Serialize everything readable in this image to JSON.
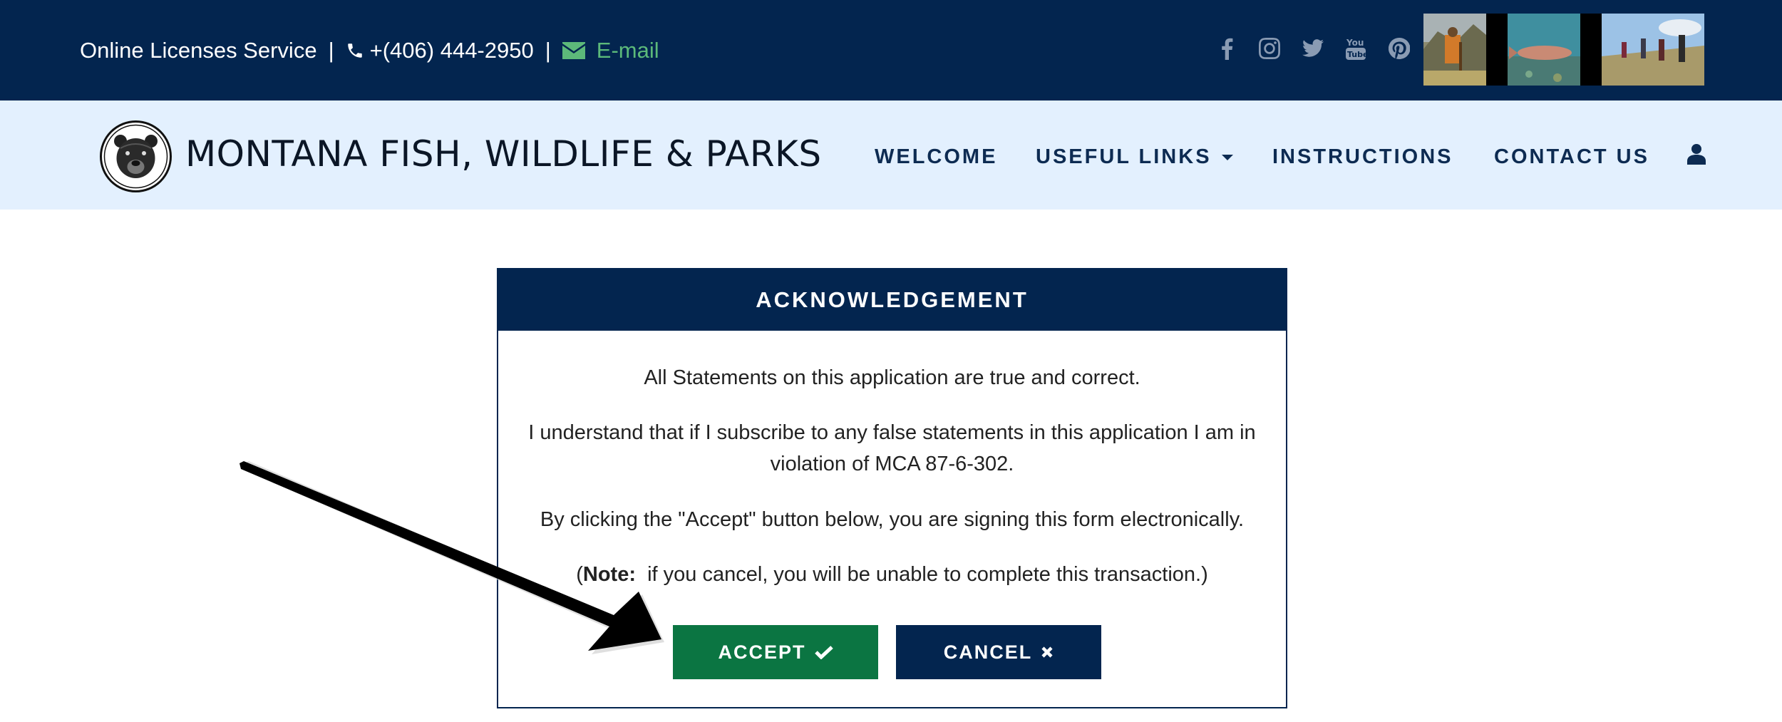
{
  "topbar": {
    "service": "Online Licenses Service",
    "separator": "|",
    "phone": "+(406) 444-2950",
    "email_label": "E-mail",
    "social_icons": [
      "facebook-icon",
      "instagram-icon",
      "twitter-icon",
      "youtube-icon",
      "pinterest-icon"
    ]
  },
  "nav": {
    "brand": "MONTANA FISH, WILDLIFE & PARKS",
    "welcome": "WELCOME",
    "useful_links": "USEFUL LINKS",
    "instructions": "INSTRUCTIONS",
    "contact_us": "CONTACT US",
    "user_icon": "user-icon"
  },
  "dialog": {
    "title": "ACKNOWLEDGEMENT",
    "line1": "All Statements on this application are true and correct.",
    "line2": "I understand that if I subscribe to any false statements in this application I am in violation of MCA 87-6-302.",
    "line3": "By clicking the \"Accept\" button below, you are signing this form electronically.",
    "note_open": "(",
    "note_label": "Note:",
    "note_text": "  if you cancel, you will be unable to complete this transaction.)",
    "accept_label": "ACCEPT",
    "cancel_label": "CANCEL"
  },
  "colors": {
    "navy": "#03254f",
    "nav_bg": "#e3f0fe",
    "accept_green": "#0b7542",
    "email_green": "#5cb97a"
  }
}
